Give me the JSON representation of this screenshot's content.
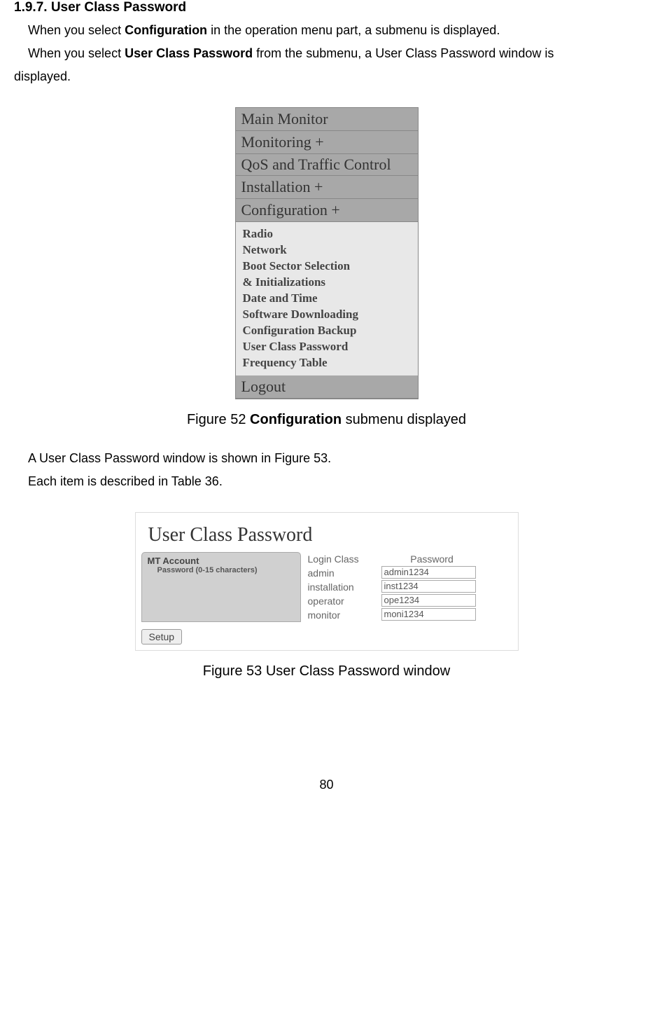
{
  "heading": "1.9.7. User Class Password",
  "para1_pre": "When you select ",
  "para1_bold": "Configuration",
  "para1_post": " in the operation menu part, a submenu is displayed.",
  "para2_pre": "When you select ",
  "para2_bold": "User Class Password",
  "para2_post": " from the submenu, a User Class Password window is",
  "para2_line2": "displayed.",
  "menu": {
    "items": [
      "Main Monitor",
      "Monitoring +",
      "QoS and Traffic Control",
      "Installation +",
      "Configuration +"
    ],
    "submenu": [
      "Radio",
      "Network",
      "Boot Sector Selection",
      "& Initializations",
      "Date and Time",
      "Software Downloading",
      "Configuration Backup",
      "User Class Password",
      "Frequency Table"
    ],
    "footer": "Logout"
  },
  "figure52_pre": "Figure 52 ",
  "figure52_bold": "Configuration",
  "figure52_post": " submenu displayed",
  "para3": "A User Class Password window is shown in Figure 53.",
  "para4": "Each item is described in Table 36.",
  "ucp": {
    "title": "User Class Password",
    "tab_label": "MT Account",
    "tab_sub": "Password (0-15 characters)",
    "col1_header": "Login Class",
    "col2_header": "Password",
    "rows": [
      {
        "class": "admin",
        "password": "admin1234"
      },
      {
        "class": "installation",
        "password": "inst1234"
      },
      {
        "class": "operator",
        "password": "ope1234"
      },
      {
        "class": "monitor",
        "password": "moni1234"
      }
    ],
    "setup_button": "Setup"
  },
  "figure53": "Figure 53 User Class Password window",
  "page_number": "80"
}
